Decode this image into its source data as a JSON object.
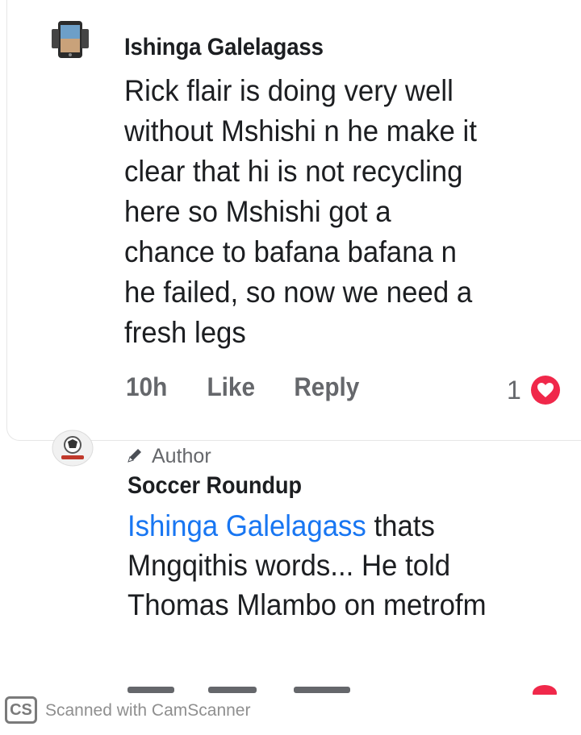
{
  "comment1": {
    "author": "Ishinga Galelagass",
    "avatar_icon": "phone-avatar-icon",
    "text": "Rick flair is doing very well\nwithout Mshishi n he make it\nclear that hi is not recycling\nhere so Mshishi got a\nchance to bafana bafana n\nhe failed, so now we need a\nfresh legs",
    "time": "10h",
    "like_label": "Like",
    "reply_label": "Reply",
    "reaction_count": "1",
    "reaction_icon": "heart-icon"
  },
  "comment2": {
    "badge_label": "Author",
    "badge_icon": "pencil-icon",
    "author": "Soccer Roundup",
    "avatar_icon": "page-logo-icon",
    "mention": "Ishinga Galelagass",
    "text": " thats Mngqithis words... He told Thomas Mlambo on metrofm"
  },
  "watermark": {
    "logo": "CS",
    "text": "Scanned with CamScanner"
  },
  "colors": {
    "mention": "#1876f2",
    "secondary_text": "#65676b",
    "reaction": "#f0284a"
  }
}
